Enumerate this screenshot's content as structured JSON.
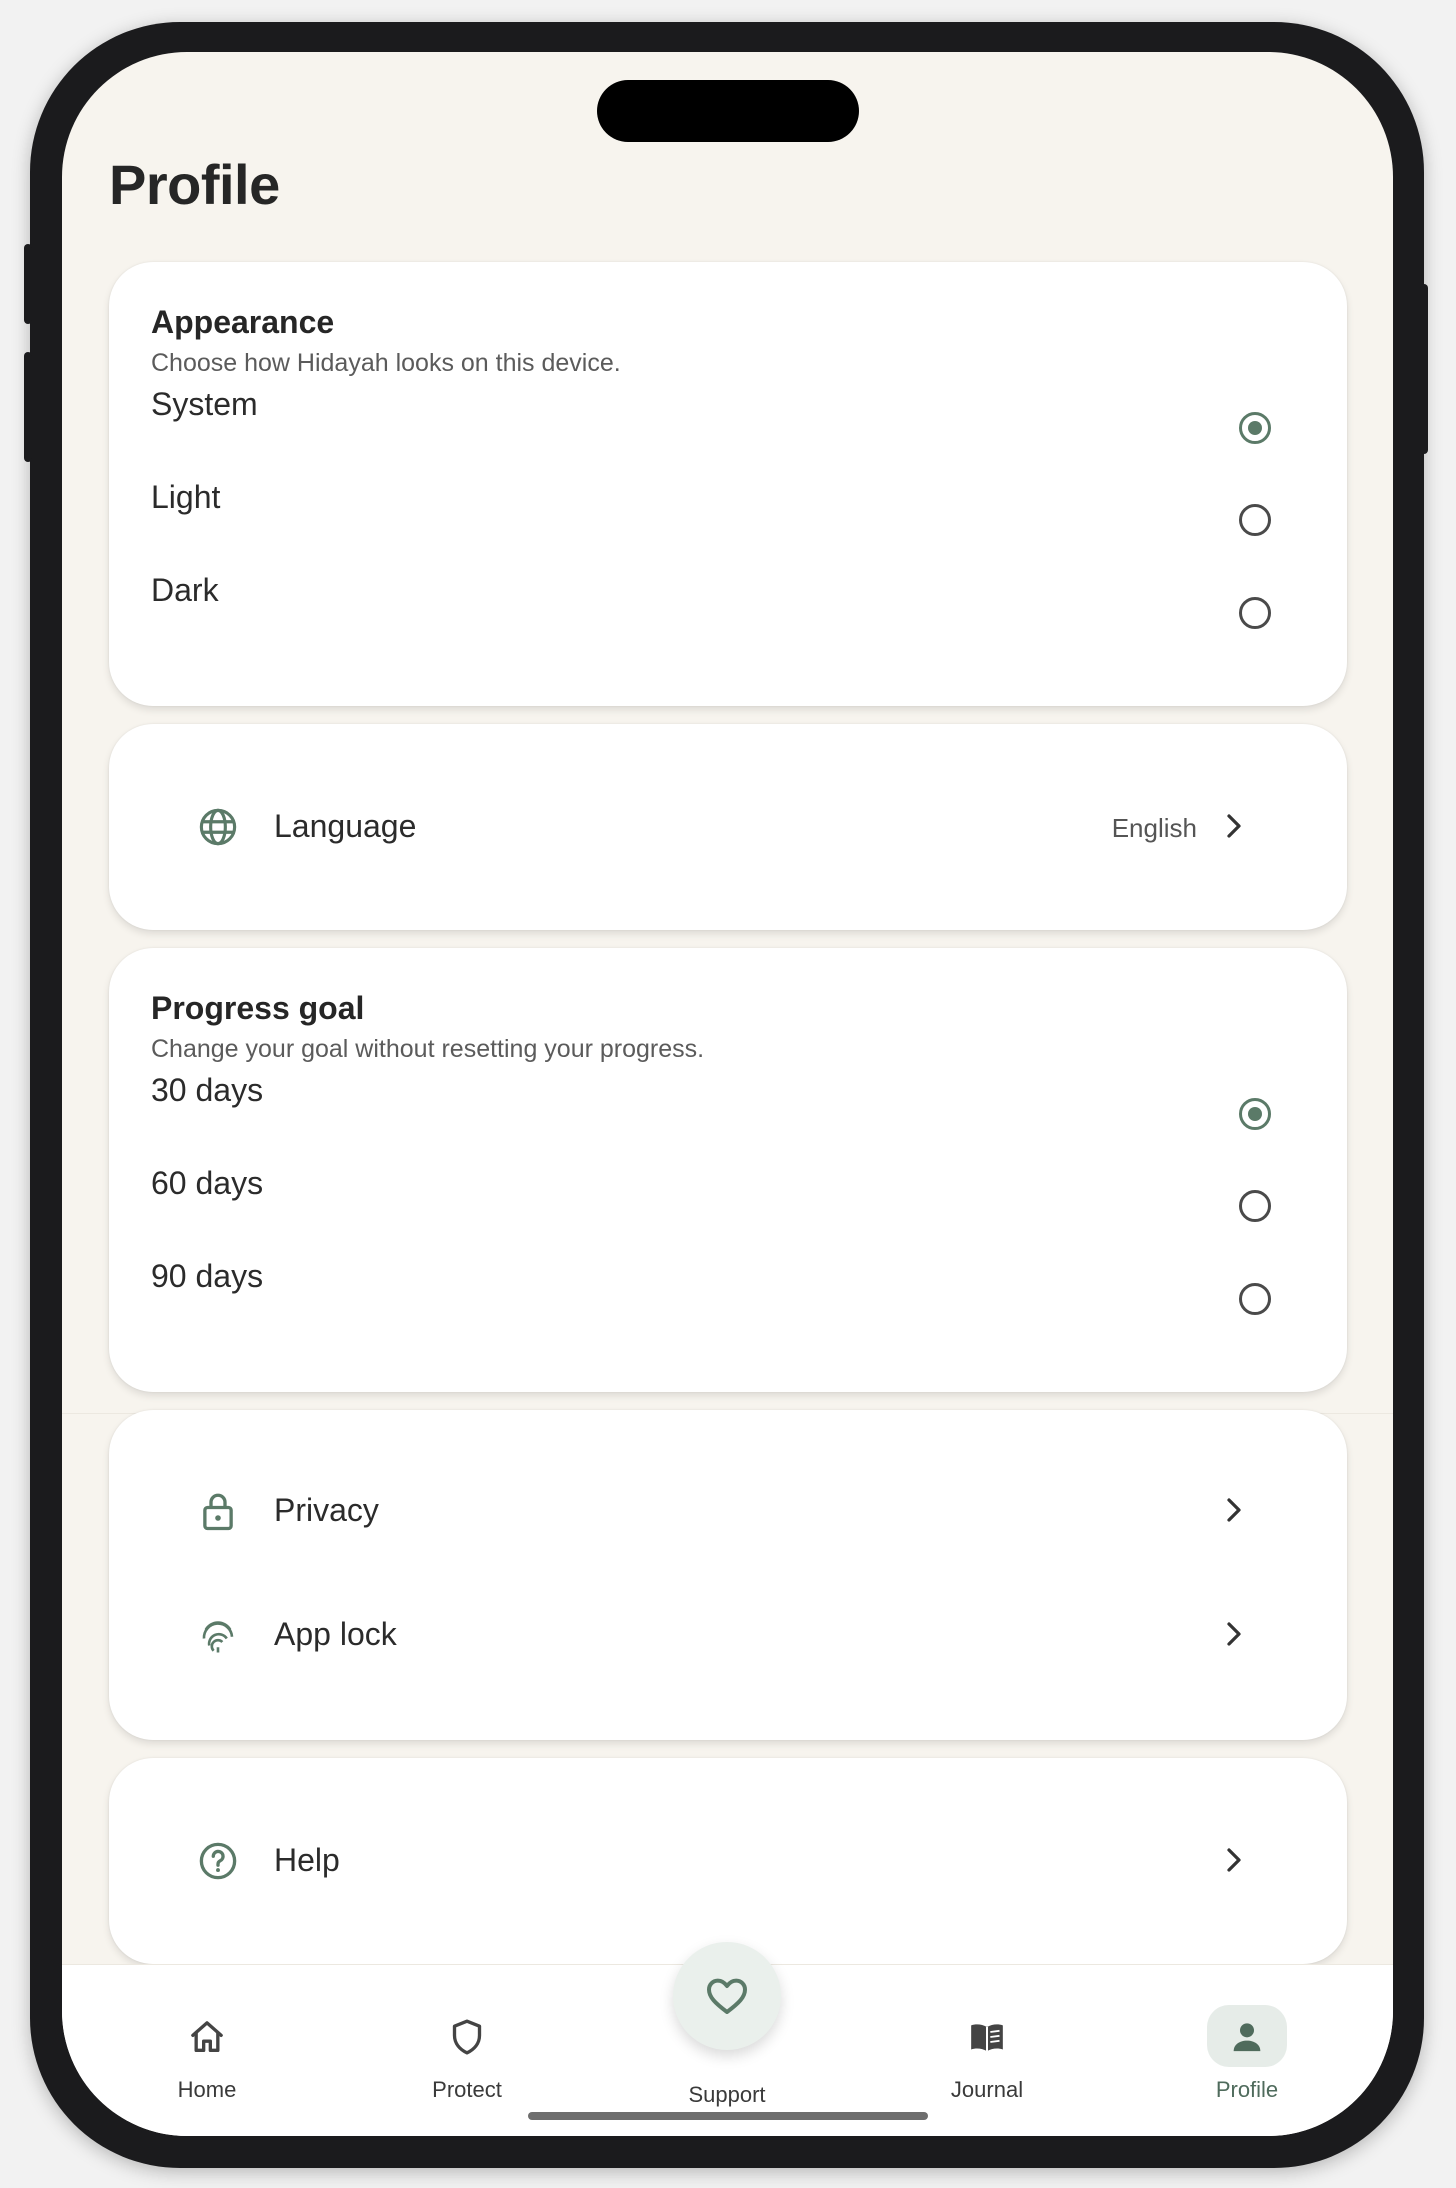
{
  "page": {
    "title": "Profile"
  },
  "appearance": {
    "title": "Appearance",
    "subtitle": "Choose how Hidayah looks on this device.",
    "options": [
      {
        "label": "System",
        "selected": true
      },
      {
        "label": "Light",
        "selected": false
      },
      {
        "label": "Dark",
        "selected": false
      }
    ]
  },
  "language": {
    "label": "Language",
    "value": "English"
  },
  "progress_goal": {
    "title": "Progress goal",
    "subtitle": "Change your goal without resetting your progress.",
    "options": [
      {
        "label": "30 days",
        "selected": true
      },
      {
        "label": "60 days",
        "selected": false
      },
      {
        "label": "90 days",
        "selected": false
      }
    ]
  },
  "security": {
    "items": [
      {
        "label": "Privacy",
        "icon": "lock-icon"
      },
      {
        "label": "App lock",
        "icon": "fingerprint-icon"
      }
    ]
  },
  "help": {
    "label": "Help",
    "icon": "help-circle-icon"
  },
  "nav": {
    "items": [
      {
        "label": "Home",
        "icon": "home-icon",
        "active": false
      },
      {
        "label": "Protect",
        "icon": "shield-icon",
        "active": false
      },
      {
        "label": "Support",
        "icon": "heart-icon",
        "active": false
      },
      {
        "label": "Journal",
        "icon": "book-icon",
        "active": false
      },
      {
        "label": "Profile",
        "icon": "person-icon",
        "active": true
      }
    ]
  },
  "colors": {
    "accent": "#5b7a68",
    "background": "#f7f4ee",
    "card": "#ffffff",
    "active_pill": "#e6ece8"
  }
}
